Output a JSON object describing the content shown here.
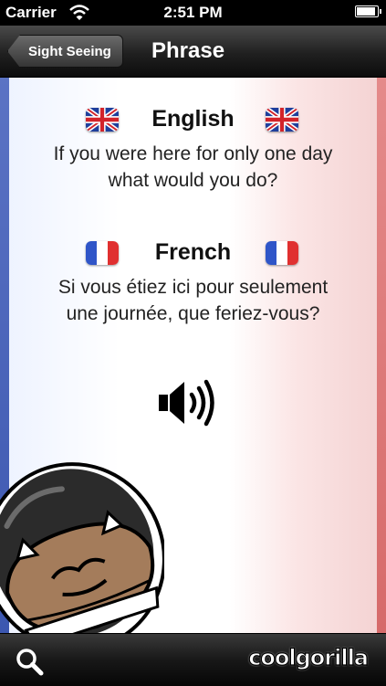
{
  "status_bar": {
    "carrier": "Carrier",
    "time": "2:51 PM",
    "battery_level": 0.9
  },
  "nav": {
    "back_label": "Sight Seeing",
    "title": "Phrase"
  },
  "phrase": {
    "source": {
      "language": "English",
      "text_line1": "If you were here for only one day",
      "text_line2": "what would you do?"
    },
    "target": {
      "language": "French",
      "text_line1": "Si vous étiez ici pour seulement",
      "text_line2": "une journée, que feriez-vous?"
    }
  },
  "toolbar": {
    "brand": "coolgorilla"
  },
  "colors": {
    "flag_blue": "#3c57b0",
    "flag_red": "#d66a6a",
    "uk_blue": "#1f3f9c",
    "uk_red": "#d2232a"
  }
}
